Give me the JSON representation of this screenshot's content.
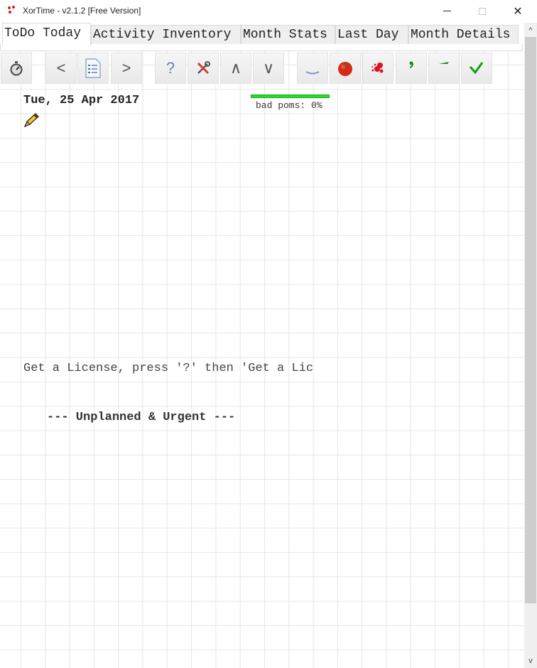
{
  "window": {
    "title": "XorTime - v2.1.2 [Free Version]",
    "app_icon": "xortime-dots-icon",
    "controls": {
      "minimize": "minimize",
      "maximize": "maximize",
      "close": "✕"
    }
  },
  "tabs": [
    {
      "label": "ToDo Today",
      "active": true
    },
    {
      "label": "Activity Inventory",
      "active": false
    },
    {
      "label": "Month Stats",
      "active": false
    },
    {
      "label": "Last Day",
      "active": false
    },
    {
      "label": "Month Details",
      "active": false
    }
  ],
  "toolbar": {
    "buttons": [
      {
        "name": "stopwatch",
        "icon": "stopwatch-icon"
      },
      {
        "name": "previous",
        "icon": "chevron-left-icon",
        "glyph": "<"
      },
      {
        "name": "list",
        "icon": "list-document-icon"
      },
      {
        "name": "next",
        "icon": "chevron-right-icon",
        "glyph": ">"
      },
      {
        "name": "help",
        "icon": "question-icon",
        "glyph": "?"
      },
      {
        "name": "tools",
        "icon": "tools-icon"
      },
      {
        "name": "move-up",
        "icon": "chevron-up-icon",
        "glyph": "∧"
      },
      {
        "name": "move-down",
        "icon": "chevron-down-icon",
        "glyph": "∨"
      },
      {
        "name": "underline",
        "icon": "underline-mark-icon"
      },
      {
        "name": "tomato",
        "icon": "tomato-icon"
      },
      {
        "name": "splat",
        "icon": "splat-icon"
      },
      {
        "name": "comma",
        "icon": "comma-mark-icon"
      },
      {
        "name": "dash",
        "icon": "dash-mark-icon"
      },
      {
        "name": "done",
        "icon": "checkmark-icon"
      }
    ]
  },
  "day": {
    "date": "Tue, 25 Apr 2017",
    "edit_icon": "pencil-icon",
    "bad_poms_label": "bad poms: 0%",
    "bad_poms_percent": 0,
    "bar_color": "#22e022"
  },
  "notes": {
    "license_hint": "Get a License, press '?' then 'Get a Lic",
    "section_header": "--- Unplanned & Urgent ---"
  },
  "scrollbar": {
    "up": "^",
    "down": "v"
  }
}
